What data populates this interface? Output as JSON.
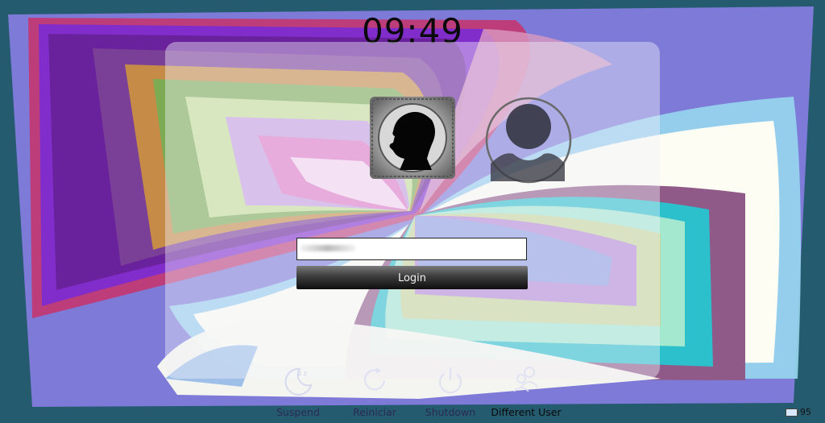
{
  "clock": {
    "time": "09:49"
  },
  "users": [
    {
      "name": "current-user",
      "selected": true
    },
    {
      "name": "other-user",
      "selected": false
    }
  ],
  "login": {
    "password_value": "",
    "button_label": "Login"
  },
  "actions": [
    {
      "id": "suspend",
      "label": "Suspend",
      "icon": "moon-sleep-icon"
    },
    {
      "id": "reiniciar",
      "label": "Reiniciar",
      "icon": "restart-icon"
    },
    {
      "id": "shutdown",
      "label": "Shutdown",
      "icon": "power-icon"
    },
    {
      "id": "different-user",
      "label": "Different User",
      "icon": "users-icon"
    }
  ],
  "tray": {
    "battery_text": "95",
    "battery_icon": "battery-icon"
  },
  "colors": {
    "panel": "#e8e8f5",
    "button_dark": "#0e0e0e",
    "accent_purple": "#7b3fc8"
  }
}
